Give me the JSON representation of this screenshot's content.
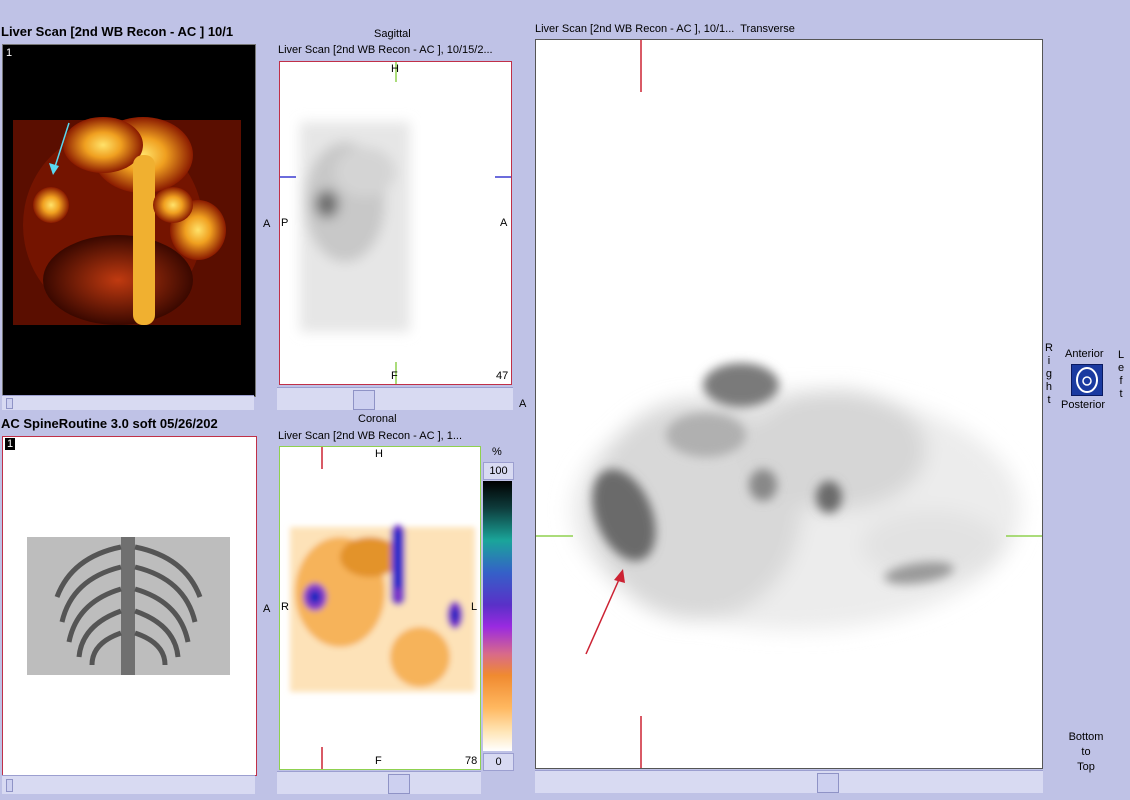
{
  "mip": {
    "title": "Liver Scan [2nd WB Recon - AC ] 10/1",
    "frame": "1"
  },
  "ct": {
    "title": "AC  SpineRoutine  3.0  soft 05/26/202",
    "frame": "1"
  },
  "sagittal": {
    "view_name": "Sagittal",
    "series": "Liver Scan [2nd WB Recon - AC ], 10/15/2...",
    "top": "H",
    "bottom": "F",
    "left": "P",
    "right": "A",
    "outer_left": "A",
    "outer_bottom_right": "A",
    "slice": "47"
  },
  "coronal": {
    "view_name": "Coronal",
    "series": "Liver Scan [2nd WB Recon - AC ], 1...",
    "top": "H",
    "bottom": "F",
    "left": "R",
    "right": "L",
    "outer_left": "A",
    "slice": "78"
  },
  "colorbar": {
    "unit": "%",
    "max": "100",
    "min": "0"
  },
  "transverse": {
    "series": "Liver Scan [2nd WB Recon - AC ], 10/1...",
    "view_name": "Transverse"
  },
  "orientation": {
    "right": [
      "R",
      "i",
      "g",
      "h",
      "t"
    ],
    "left": [
      "L",
      "e",
      "f",
      "t"
    ],
    "anterior": "Anterior",
    "posterior": "Posterior",
    "direction": [
      "Bottom",
      "to",
      "Top"
    ]
  },
  "colors": {
    "accent_red": "#cc2233",
    "crosshair_green": "#8fd14f",
    "background": "#bfc2e6"
  }
}
